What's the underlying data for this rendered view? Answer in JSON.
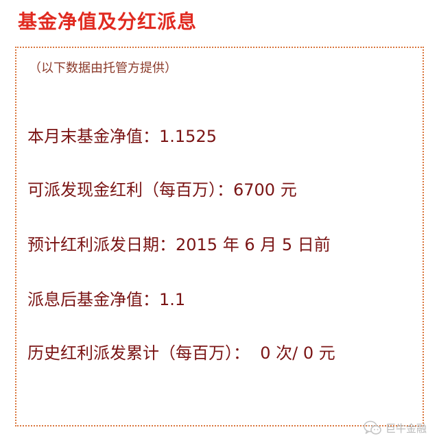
{
  "header": {
    "title": "基金净值及分红派息"
  },
  "panel": {
    "note": "（以下数据由托管方提供）",
    "rows": [
      {
        "label": "本月末基金净值：",
        "value": "1.1525"
      },
      {
        "label": "可派发现金红利（每百万）：",
        "value": "6700 元"
      },
      {
        "label": "预计红利派发日期：",
        "value": "2015 年 6 月 5 日前"
      },
      {
        "label": "派息后基金净值：",
        "value": "1.1"
      },
      {
        "label": "历史红利派发累计（每百万）：",
        "value": "  0 次/ 0 元"
      }
    ]
  },
  "watermark": {
    "icon": "wechat-icon",
    "text": "巨牛金融"
  },
  "colors": {
    "title": "#e02a20",
    "text": "#7a1414",
    "border": "#d9743a"
  }
}
